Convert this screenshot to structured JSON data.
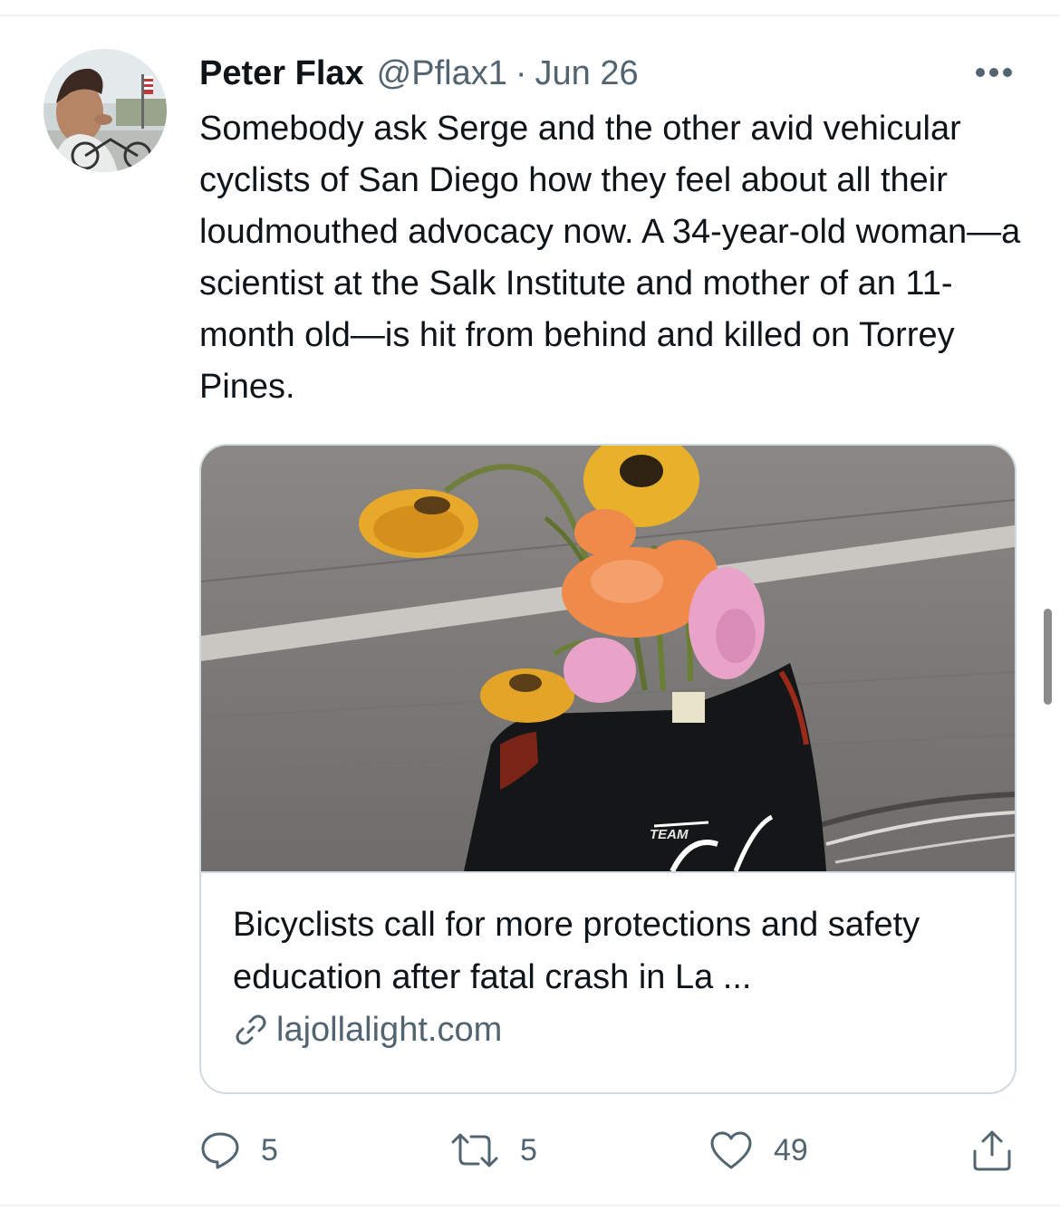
{
  "tweet": {
    "author": {
      "name": "Peter Flax",
      "handle": "@Pflax1",
      "avatar_icon": "avatar-photo"
    },
    "separator": "·",
    "timestamp": "Jun 26",
    "text": "Somebody ask Serge and the other avid vehicular cyclists of San Diego how they feel about all their loudmouthed advocacy now. A 34-year-old woman—a scientist at the Salk Institute and mother of an 11-month old—is hit from behind and killed on Torrey Pines.",
    "card": {
      "image_icon": "roadside-memorial-photo",
      "image_text": "TEAM",
      "title": "Bicyclists call for more protections and safety education after fatal crash in La ...",
      "domain": "lajollalight.com",
      "link_icon": "link-icon"
    },
    "actions": {
      "reply": {
        "icon": "reply-icon",
        "count": "5"
      },
      "retweet": {
        "icon": "retweet-icon",
        "count": "5"
      },
      "like": {
        "icon": "heart-icon",
        "count": "49"
      },
      "share": {
        "icon": "share-icon"
      }
    },
    "colors": {
      "text": "#0f1419",
      "secondary": "#536471",
      "border": "#cfd9de",
      "divider": "#eff3f4"
    }
  }
}
